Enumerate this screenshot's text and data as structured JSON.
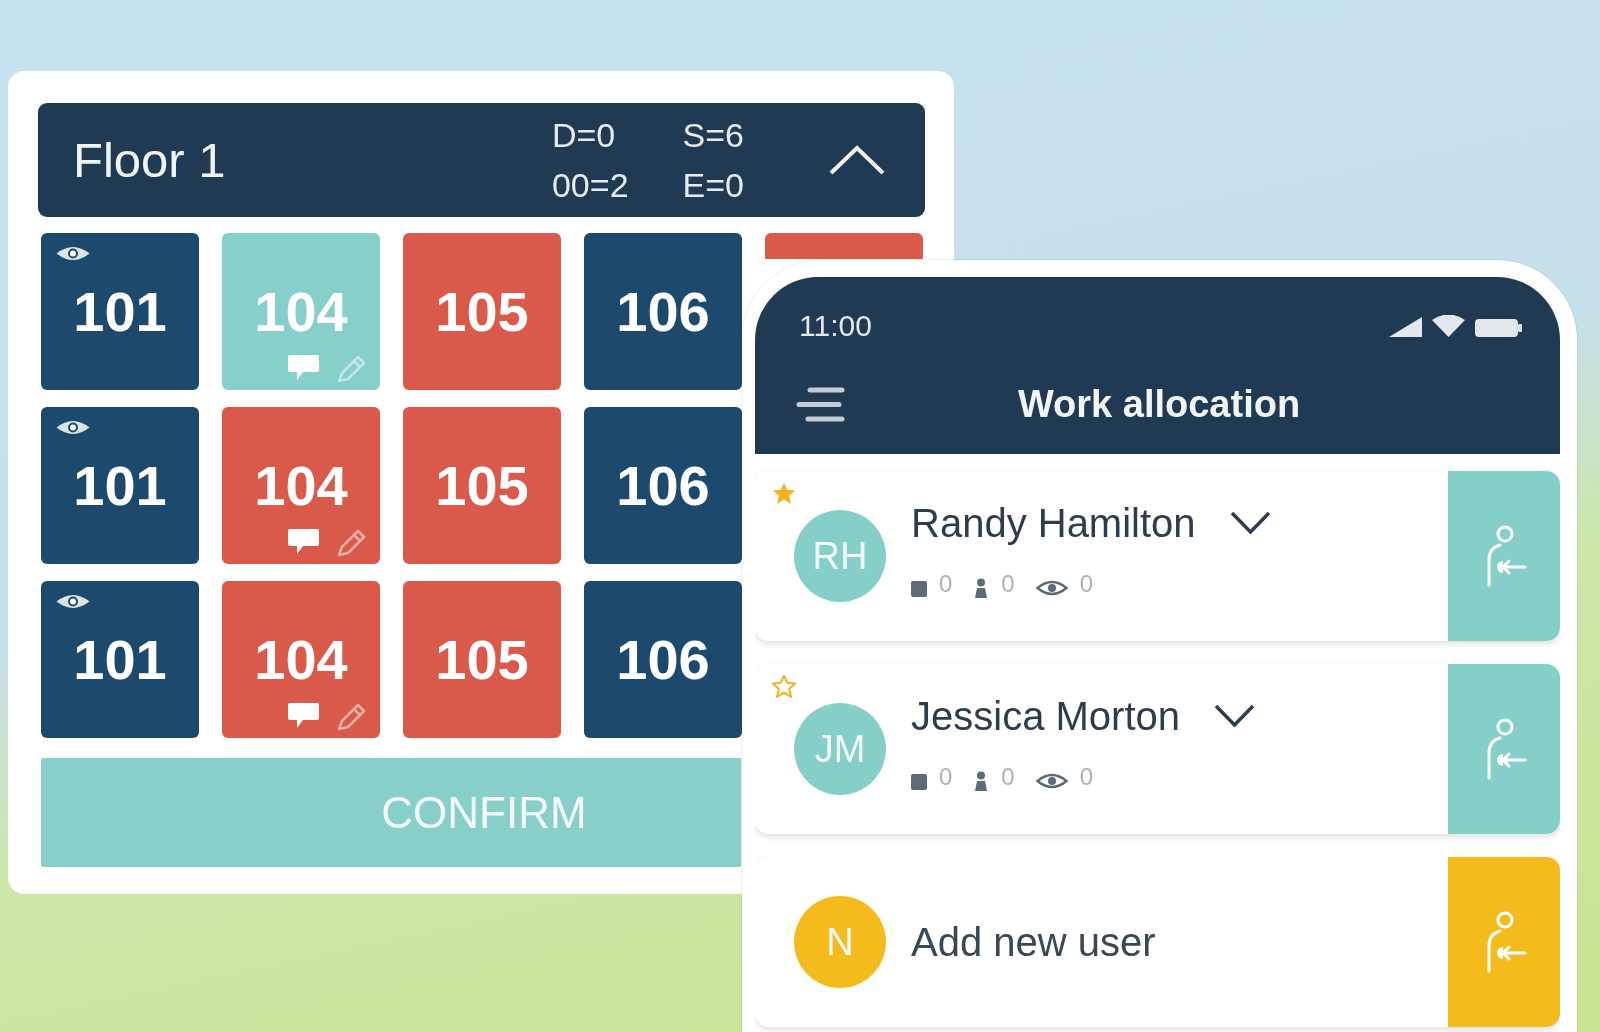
{
  "floor_panel": {
    "title": "Floor 1",
    "counts": [
      "D=0",
      "S=6",
      "00=2",
      "E=0"
    ],
    "expanded": true,
    "room_rows": [
      {
        "rooms": [
          {
            "number": "101",
            "color": "#1d4a6c",
            "viewed": true,
            "comment": false,
            "pencil": false
          },
          {
            "number": "104",
            "color": "#87cfca",
            "viewed": false,
            "comment": true,
            "pencil": true
          },
          {
            "number": "105",
            "color": "#d95a4a",
            "viewed": false,
            "comment": false,
            "pencil": false
          },
          {
            "number": "106",
            "color": "#1d4a6c",
            "viewed": false,
            "comment": false,
            "pencil": false
          },
          {
            "color": "#d95a4a",
            "viewed": false,
            "comment": false,
            "pencil": false
          }
        ]
      },
      {
        "rooms": [
          {
            "number": "101",
            "color": "#1d4a6c",
            "viewed": true,
            "comment": false,
            "pencil": false
          },
          {
            "number": "104",
            "color": "#d95a4a",
            "viewed": false,
            "comment": true,
            "pencil": true
          },
          {
            "number": "105",
            "color": "#d95a4a",
            "viewed": false,
            "comment": false,
            "pencil": false
          },
          {
            "number": "106",
            "color": "#1d4a6c",
            "viewed": false,
            "comment": false,
            "pencil": false
          }
        ]
      },
      {
        "rooms": [
          {
            "number": "101",
            "color": "#1d4a6c",
            "viewed": true,
            "comment": false,
            "pencil": false
          },
          {
            "number": "104",
            "color": "#d95a4a",
            "viewed": false,
            "comment": true,
            "pencil": true
          },
          {
            "number": "105",
            "color": "#d95a4a",
            "viewed": false,
            "comment": false,
            "pencil": false
          },
          {
            "number": "106",
            "color": "#1d4a6c",
            "viewed": false,
            "comment": false,
            "pencil": false
          }
        ]
      }
    ],
    "confirm_button": "CONFIRM"
  },
  "phone": {
    "status_bar": {
      "time": "11:00"
    },
    "app_bar": {
      "title": "Work allocation"
    },
    "users": [
      {
        "kind": "user",
        "initials": "RH",
        "name": "Randy Hamilton",
        "color": "#86cfc9",
        "favorite": true,
        "expanded": false,
        "stats": [
          {
            "kind": "block",
            "value": "0"
          },
          {
            "kind": "person",
            "value": "0"
          },
          {
            "kind": "eye",
            "value": "0"
          }
        ]
      },
      {
        "kind": "user",
        "initials": "JM",
        "name": "Jessica Morton",
        "color": "#86cfc9",
        "favorite": false,
        "expanded": false,
        "stats": [
          {
            "kind": "block",
            "value": "0"
          },
          {
            "kind": "person",
            "value": "0"
          },
          {
            "kind": "eye",
            "value": "0"
          }
        ]
      },
      {
        "kind": "add",
        "initials": "N",
        "name": "Add new user",
        "color": "#f3bb1c"
      }
    ]
  }
}
